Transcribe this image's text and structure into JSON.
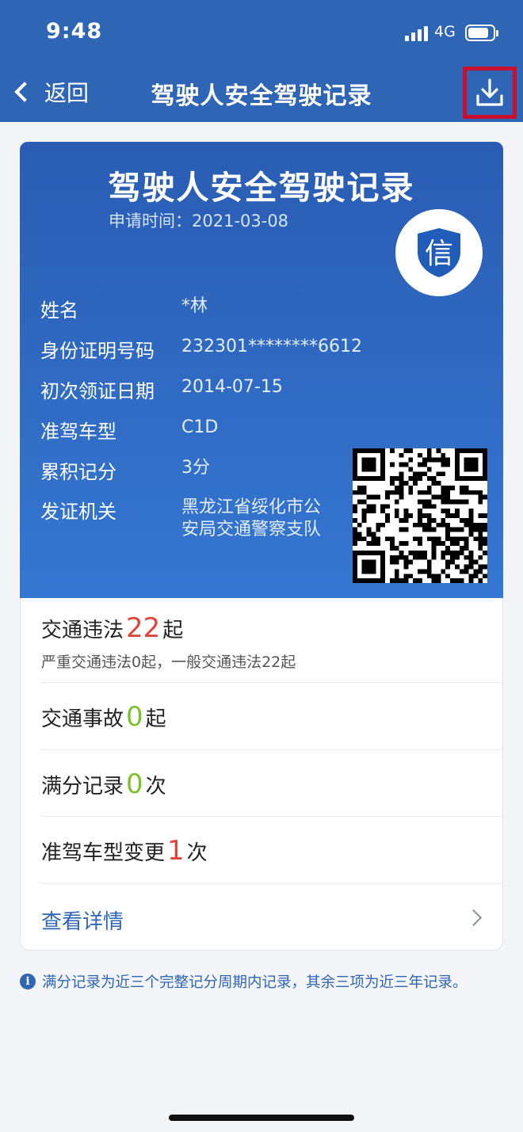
{
  "status_bar": {
    "time": "9:48",
    "network": "4G"
  },
  "nav": {
    "back_label": "返回",
    "title": "驾驶人安全驾驶记录",
    "download_icon": "download-icon"
  },
  "card": {
    "title": "驾驶人安全驾驶记录",
    "apply_label": "申请时间：",
    "apply_date": "2021-03-08",
    "badge_char": "信",
    "fields": [
      {
        "label": "姓名",
        "value": "*林"
      },
      {
        "label": "身份证明号码",
        "value": "232301********6612"
      },
      {
        "label": "初次领证日期",
        "value": "2014-07-15"
      },
      {
        "label": "准驾车型",
        "value": "C1D"
      },
      {
        "label": "累积记分",
        "value": "3分"
      },
      {
        "label": "发证机关",
        "value_line1": "黑龙江省绥化市公",
        "value_line2": "安局交通警察支队"
      }
    ]
  },
  "stats": {
    "violations": {
      "label": "交通违法",
      "count": "22",
      "unit": "起",
      "sub": "严重交通违法0起，一般交通违法22起"
    },
    "accidents": {
      "label": "交通事故",
      "count": "0",
      "unit": "起"
    },
    "full_score": {
      "label": "满分记录",
      "count": "0",
      "unit": "次"
    },
    "class_change": {
      "label": "准驾车型变更",
      "count": "1",
      "unit": "次"
    },
    "detail_link": "查看详情"
  },
  "note": "满分记录为近三个完整记分周期内记录，其余三项为近三年记录。",
  "colors": {
    "header": "#2f65b5",
    "accent_red": "#e0453c",
    "accent_green": "#7cc12d",
    "highlight_box": "#c8102e"
  }
}
